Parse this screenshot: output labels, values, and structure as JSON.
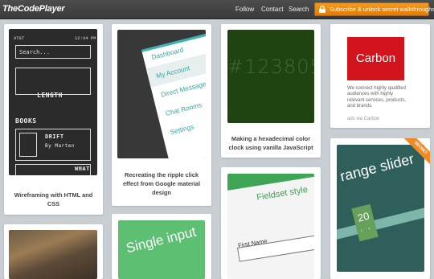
{
  "header": {
    "logo": "TheCodePlayer",
    "nav": [
      "Follow",
      "Contact",
      "Search"
    ],
    "subscribe_label": "Subscribe & unlock secret walkthroughs"
  },
  "cards": {
    "wireframing": {
      "caption": "Wireframing with HTML and CSS",
      "thumb": {
        "carrier": "AT&T",
        "time": "12:34 PM",
        "search_placeholder": "Search...",
        "length": "LENGTH",
        "books": "BOOKS",
        "book_title": "DRIFT",
        "book_author": "By Marten",
        "whats": "WHAT"
      }
    },
    "ripple": {
      "caption": "Recreating the ripple click effect from Google material design",
      "menu_items": [
        "Dashboard",
        "My Account",
        "Direct Message",
        "Chat Rooms",
        "Settings"
      ]
    },
    "hexclock": {
      "caption": "Making a hexadecimal color clock using vanilla JavaScript",
      "digits": "#123805"
    },
    "carbon": {
      "logo": "Carbon",
      "text": "We connect highly qualified audiences with highly relevant services, products, and brands.",
      "via": "ads via Carbon"
    },
    "range": {
      "title": "range slider",
      "value": "20",
      "arrows": "‹ ›",
      "ribbon": "SECRET"
    },
    "fieldset": {
      "title": "Fieldset style",
      "label": "First Name"
    },
    "singleinput": {
      "title": "Single input"
    }
  },
  "colors": {
    "accent": "#e8851a",
    "teal": "#37a7a7",
    "carbon_red": "#d4141d"
  }
}
